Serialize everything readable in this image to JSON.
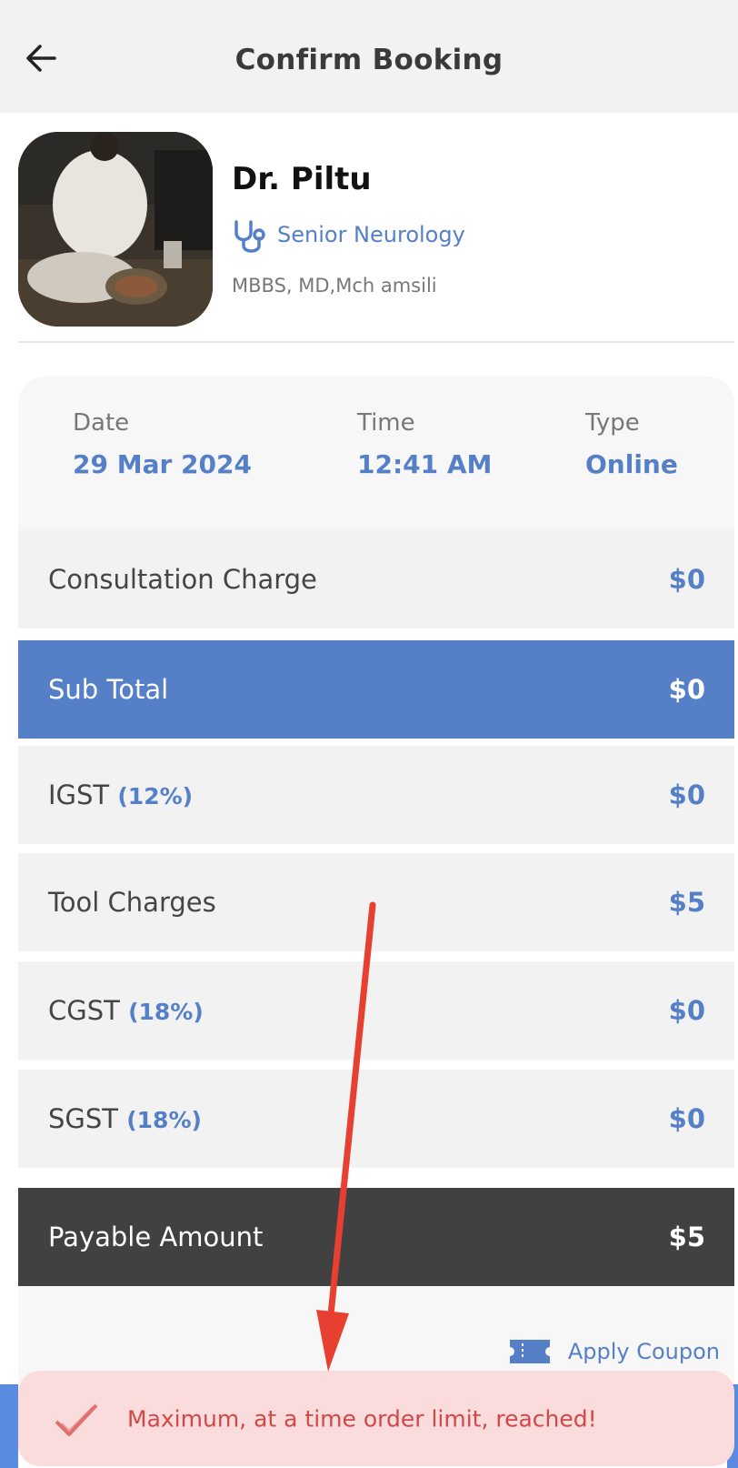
{
  "header": {
    "title": "Confirm Booking",
    "back_icon": "arrow-left-icon"
  },
  "doctor": {
    "name": "Dr. Piltu",
    "specialty": "Senior Neurology",
    "specialty_icon": "stethoscope-icon",
    "qualifications": "MBBS, MD,Mch amsili"
  },
  "booking": {
    "date_label": "Date",
    "date_value": "29 Mar 2024",
    "time_label": "Time",
    "time_value": "12:41 AM",
    "type_label": "Type",
    "type_value": "Online"
  },
  "charges": {
    "consultation": {
      "label": "Consultation Charge",
      "amount": "$0"
    },
    "subtotal": {
      "label": "Sub Total",
      "amount": "$0"
    },
    "igst": {
      "label": "IGST",
      "pct": "(12%)",
      "amount": "$0"
    },
    "tool": {
      "label": "Tool Charges",
      "amount": "$5"
    },
    "cgst": {
      "label": "CGST",
      "pct": "(18%)",
      "amount": "$0"
    },
    "sgst": {
      "label": "SGST",
      "pct": "(18%)",
      "amount": "$0"
    },
    "payable": {
      "label": "Payable Amount",
      "amount": "$5"
    }
  },
  "coupon": {
    "label": "Apply Coupon",
    "icon": "ticket-icon"
  },
  "toast": {
    "message": "Maximum, at a time order limit, reached!",
    "icon": "checkmark-icon"
  },
  "colors": {
    "accent": "#5580c8",
    "dark_row": "#414141",
    "toast_bg": "#fadcdc",
    "toast_text": "#d24848",
    "annotation_arrow": "#e84030"
  }
}
